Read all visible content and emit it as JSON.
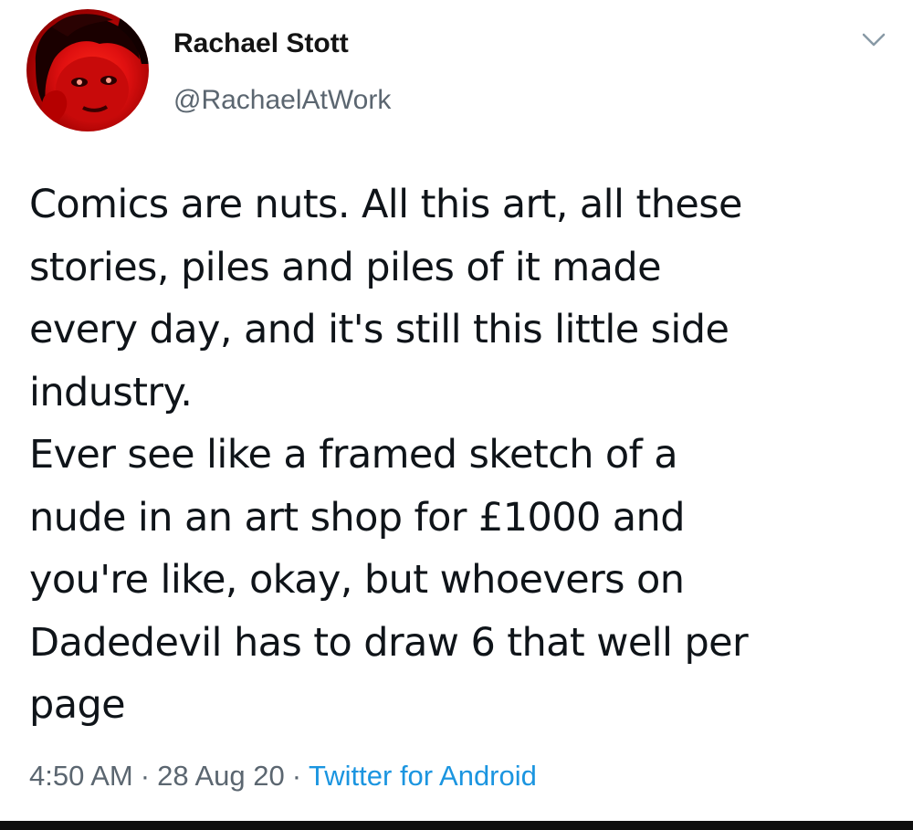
{
  "author": {
    "name": "Rachael Stott",
    "handle": "@RachaelAtWork"
  },
  "menu_icon": "chevron-down-icon",
  "tweet": {
    "lines": [
      "Comics are nuts. All this art, all these",
      "stories, piles and piles of it made",
      "every day, and it's still this little side",
      "industry.",
      "Ever see like a framed sketch of a",
      "nude in an art shop for £1000 and",
      "you're like, okay, but whoevers on",
      "Dadedevil has to draw 6 that well per",
      "page"
    ]
  },
  "meta": {
    "time": "4:50 AM",
    "separator": "·",
    "date": "28 Aug 20",
    "source": "Twitter for Android"
  },
  "colors": {
    "text": "#0f1419",
    "secondary": "#5b6670",
    "link": "#1b95e0",
    "avatar_red": "#e01010"
  }
}
